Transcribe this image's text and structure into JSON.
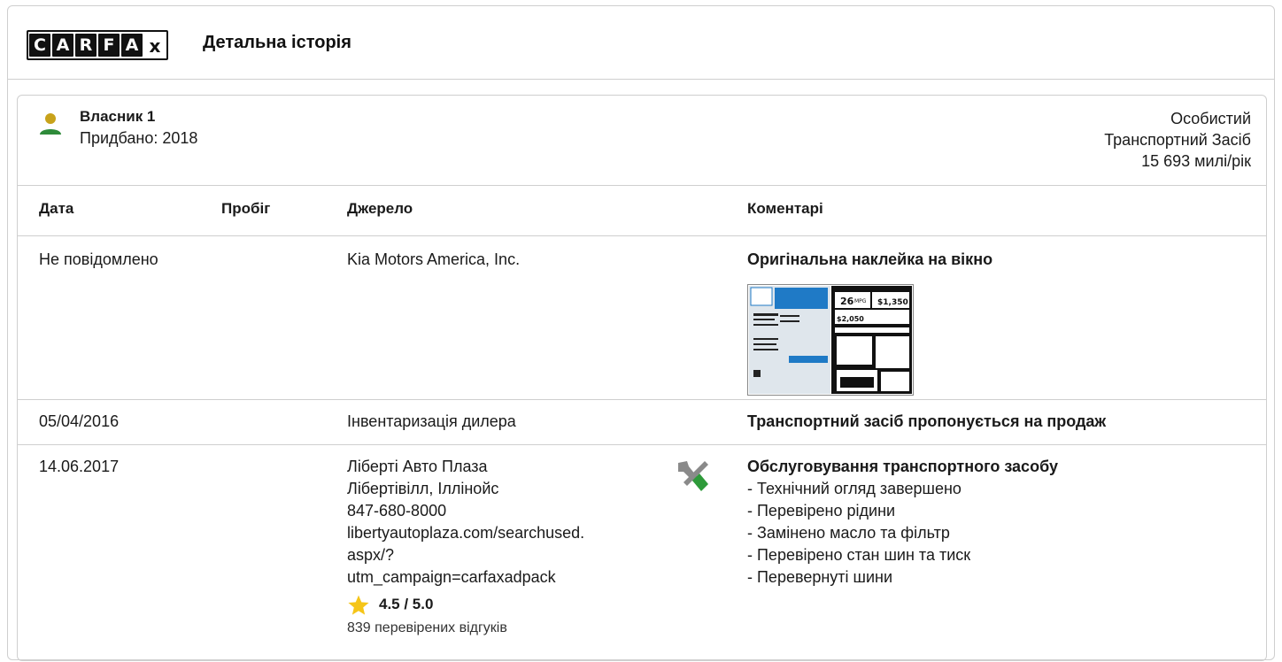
{
  "header": {
    "logo_letters": [
      "C",
      "A",
      "R",
      "F",
      "A",
      "x"
    ],
    "title": "Детальна історія"
  },
  "owner": {
    "name": "Власник 1",
    "purchased": "Придбано: 2018",
    "type_line1": "Особистий",
    "type_line2": "Транспортний Засіб",
    "mileage_per_year": "15 693 милі/рік"
  },
  "table": {
    "columns": [
      "Дата",
      "Пробіг",
      "Джерело",
      "Коментарі"
    ]
  },
  "records": [
    {
      "date": "Не повідомлено",
      "source": "Kia Motors America, Inc.",
      "comment_title": "Оригінальна наклейка на вікно"
    },
    {
      "date": "05/04/2016",
      "source": "Інвентаризація дилера",
      "comment_title": "Транспортний засіб пропонується на продаж"
    },
    {
      "date": "14.06.2017",
      "source_lines": [
        "Ліберті Авто Плаза",
        "Лібертівілл, Іллінойс",
        "847-680-8000",
        "libertyautoplaza.com/searchused.",
        "aspx/?",
        "utm_campaign=carfaxadpack"
      ],
      "rating": "4.5 / 5.0",
      "reviews": "839 перевірених відгуків",
      "comment_title": "Обслуговування транспортного засобу",
      "comment_items": [
        "- Технічний огляд завершено",
        "- Перевірено рідини",
        "- Замінено масло та фільтр",
        "- Перевірено стан шин та тиск",
        "- Перевернуті шини"
      ]
    }
  ],
  "sticker_text": {
    "mpg": "26",
    "mpg_unit": "MPG",
    "fuel_cost": "$2,050",
    "savings": "$1,350"
  },
  "colors": {
    "owner_icon_head": "#c8a21a",
    "owner_icon_body": "#2e8b3a",
    "star": "#f5c518",
    "wrench_green": "#2e9a3a",
    "wrench_gray": "#8a8a8a",
    "sticker_blue": "#1f7ac6"
  }
}
